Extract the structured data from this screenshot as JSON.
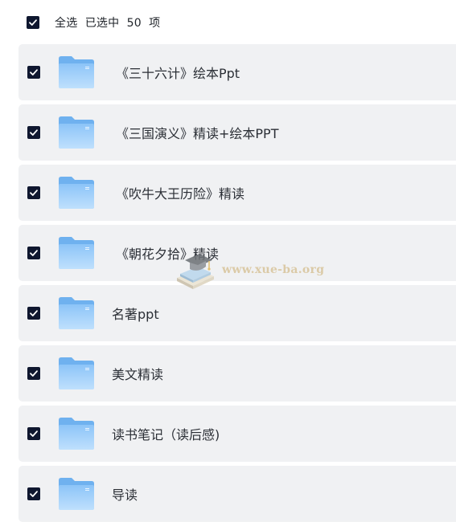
{
  "header": {
    "select_all_text": "全选  已选中  50  项"
  },
  "items": [
    {
      "label": "《三十六计》绘本Ppt",
      "checked": true
    },
    {
      "label": "《三国演义》精读+绘本PPT",
      "checked": true
    },
    {
      "label": "《吹牛大王历险》精读",
      "checked": true
    },
    {
      "label": "《朝花夕拾》精读",
      "checked": true
    },
    {
      "label": "名著ppt",
      "checked": true
    },
    {
      "label": "美文精读",
      "checked": true
    },
    {
      "label": "读书笔记（读后感)",
      "checked": true
    },
    {
      "label": "导读",
      "checked": true
    }
  ],
  "watermark": {
    "text": "www.xue-ba.org"
  },
  "colors": {
    "checkbox": "#0f172f",
    "row_background": "#f0f1f3",
    "folder_light": "#a9d4fb",
    "folder_dark": "#6fb1ef"
  },
  "icons": {
    "checkbox": "checkbox-checked-icon",
    "folder": "folder-icon",
    "watermark_logo": "graduation-cap-books-icon"
  }
}
